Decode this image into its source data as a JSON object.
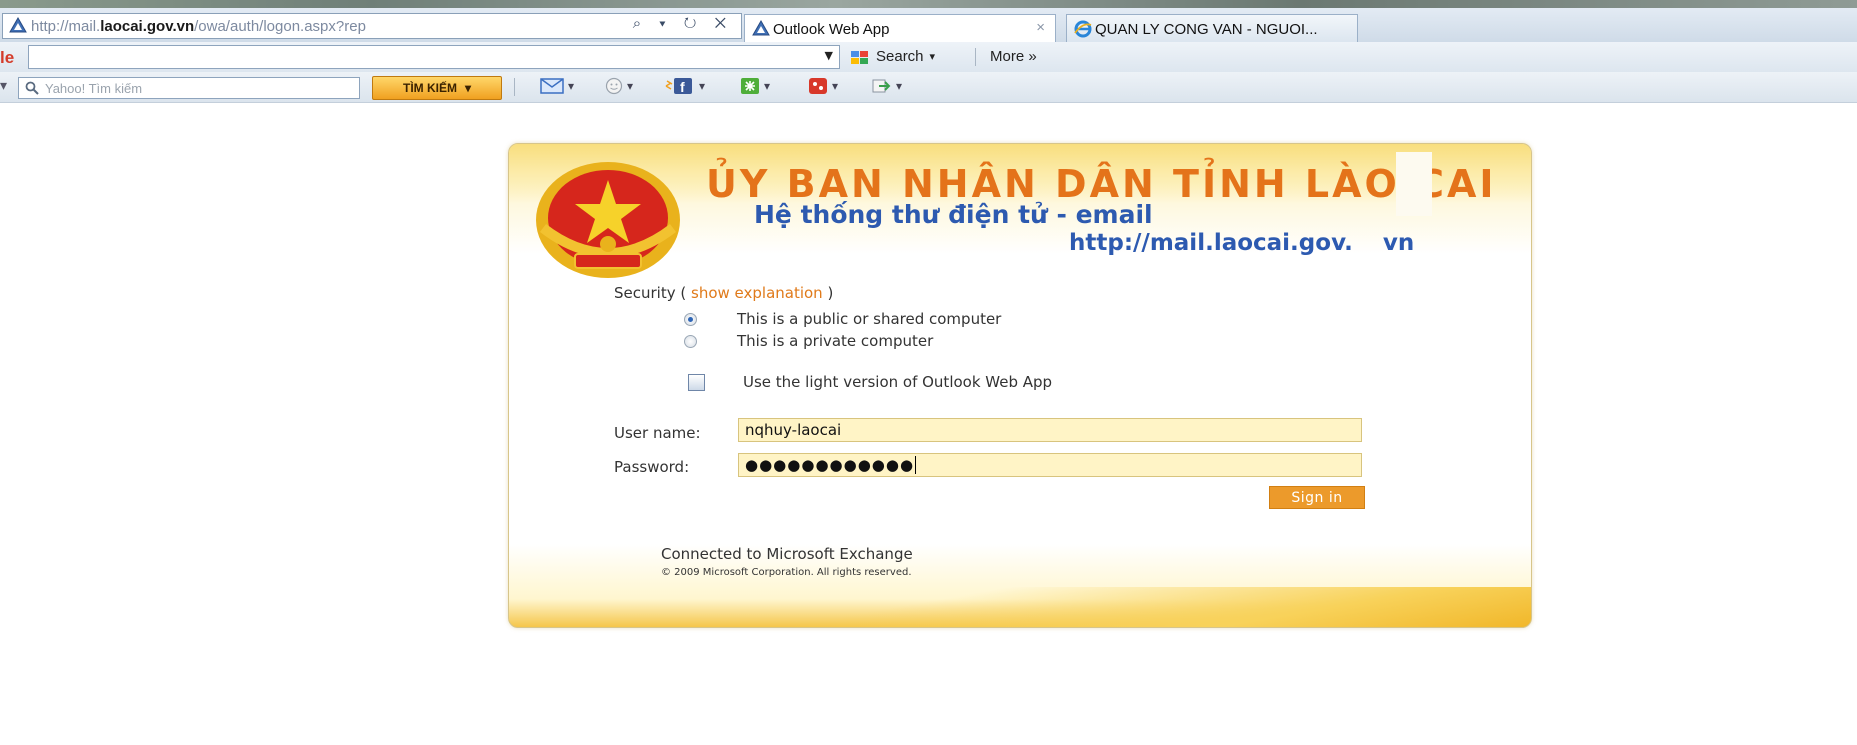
{
  "browser": {
    "url_prefix": "http://mail.",
    "url_domain": "laocai.gov.vn",
    "url_path": "/owa/auth/logon.aspx?rep",
    "address_icons": "⌕ ▾ ↻ ✕",
    "tabs": [
      {
        "title": "Outlook Web App",
        "close": "×"
      },
      {
        "title": "QUAN LY CONG VAN - NGUOI..."
      }
    ]
  },
  "google_toolbar": {
    "label": "le",
    "search_label": "Search",
    "more_label": "More »"
  },
  "yahoo_toolbar": {
    "placeholder": "Yahoo! Tìm kiếm",
    "button_label": "TÌM KIẾM"
  },
  "header": {
    "org_name": "ỦY BAN NHÂN DÂN TỈNH LÀO CAI",
    "subtitle": "Hệ thống thư điện tử - email",
    "site_url": "http://mail.laocai.gov. vn"
  },
  "form": {
    "security_prefix": "Security (",
    "security_link": "show explanation",
    "security_suffix": ")",
    "options": [
      {
        "label": "This is a public or shared computer",
        "selected": true
      },
      {
        "label": "This is a private computer",
        "selected": false
      }
    ],
    "light_version_label": "Use the light version of Outlook Web App",
    "light_version_checked": false,
    "username_label": "User name:",
    "username_value": "nqhuy-laocai",
    "password_label": "Password:",
    "password_masked": "●●●●●●●●●●●●",
    "signin_label": "Sign in"
  },
  "footer": {
    "connected": "Connected to Microsoft Exchange",
    "copyright": "© 2009 Microsoft Corporation. All rights reserved."
  },
  "colors": {
    "accent_orange": "#e4731a",
    "title_blue": "#2d5ab0",
    "signin_bg": "#ec9a2b",
    "field_bg": "#fff4c6"
  }
}
